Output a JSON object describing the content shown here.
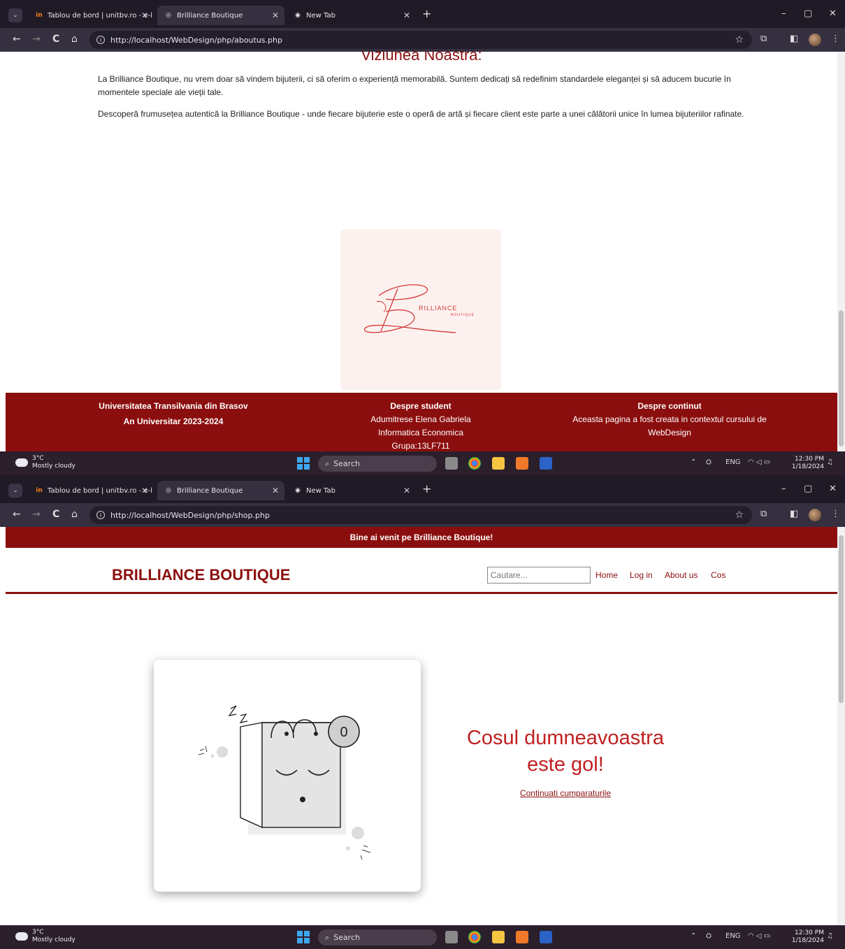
{
  "browser": {
    "tabs": [
      {
        "label": "Tablou de bord | unitbv.ro - e-l",
        "favicon": "in"
      },
      {
        "label": "Brilliance Boutique"
      },
      {
        "label": "New Tab"
      }
    ],
    "new_tab": "+",
    "window_controls": {
      "minimize": "–",
      "restore": "▢",
      "close": "✕"
    },
    "nav": {
      "back": "←",
      "forward": "→",
      "reload": "C",
      "home": "⌂"
    }
  },
  "window1": {
    "url": "http://localhost/WebDesign/php/aboutus.php",
    "about": {
      "section_title": "Viziunea Noastra:",
      "paragraph1": "La Brilliance Boutique, nu vrem doar să vindem bijuterii, ci să oferim o experiență memorabilă. Suntem dedicați să redefinim standardele eleganței și să aducem bucurie în momentele speciale ale vieții tale.",
      "paragraph2": "Descoperă frumusețea autentică la Brilliance Boutique - unde fiecare bijuterie este o operă de artă și fiecare client este parte a unei călătorii unice în lumea bijuteriilor rafinate.",
      "logo_text": "RILLIANCE",
      "logo_subtext": "BOUTIQUE"
    },
    "footer": {
      "col1": {
        "line1": "Universitatea Transilvania din Brasov",
        "line2": "An Universitar 2023-2024"
      },
      "col2": {
        "heading": "Despre student",
        "line1": "Adumitrese Elena Gabriela",
        "line2": "Informatica Economica",
        "line3": "Grupa:13LF711"
      },
      "col3": {
        "heading": "Despre continut",
        "line1": "Aceasta pagina a fost creata in contextul cursului de",
        "line2": "WebDesign"
      }
    }
  },
  "window2": {
    "url": "http://localhost/WebDesign/php/shop.php",
    "welcome_banner": "Bine ai venit pe Brilliance Boutique!",
    "brand": "BRILLIANCE BOUTIQUE",
    "search_placeholder": "Cautare...",
    "nav": [
      "Home",
      "Log in",
      "About us",
      "Cos"
    ],
    "cart": {
      "badge_count": "0",
      "empty_title_line1": "Cosul dumneavoastra",
      "empty_title_line2": "este gol!",
      "continue_link": "Continuati cumparaturile"
    }
  },
  "taskbar": {
    "temperature": "3°C",
    "weather": "Mostly cloudy",
    "search": "Search",
    "language": "ENG",
    "time": "12:30 PM",
    "date": "1/18/2024"
  },
  "colors": {
    "brand_red": "#8b0e0e",
    "accent_red": "#c02020",
    "chrome_dark": "#1f1a26"
  }
}
